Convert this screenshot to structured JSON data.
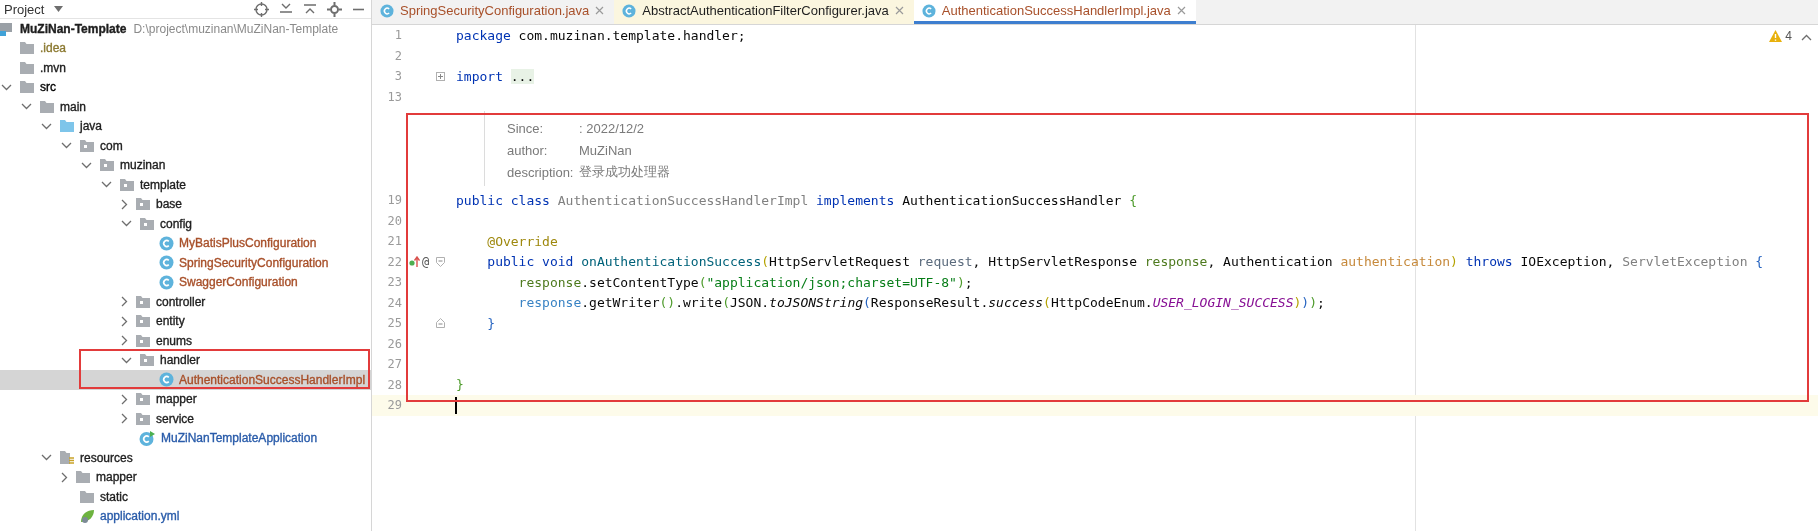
{
  "project_panel": {
    "title": "Project",
    "tree": [
      {
        "label": "MuZiNan-Template",
        "location": "D:\\project\\muzinan\\MuZiNan-Template",
        "kind": "module",
        "color": "#1e1e1e",
        "selected": false,
        "children": [
          {
            "label": ".idea",
            "kind": "folder",
            "color": "#8c7a32",
            "selected": false
          },
          {
            "label": ".mvn",
            "kind": "folder",
            "color": "#1e1e1e",
            "selected": false
          },
          {
            "label": "src",
            "kind": "folder",
            "color": "#000000",
            "expanded": true,
            "selected": false,
            "children": [
              {
                "label": "main",
                "kind": "folder",
                "color": "#1e1e1e",
                "expanded": true,
                "selected": false,
                "children": [
                  {
                    "label": "java",
                    "kind": "source-root",
                    "color": "#1e1e1e",
                    "expanded": true,
                    "selected": false,
                    "children": [
                      {
                        "label": "com",
                        "kind": "package",
                        "color": "#1e1e1e",
                        "expanded": true,
                        "selected": false,
                        "children": [
                          {
                            "label": "muzinan",
                            "kind": "package",
                            "color": "#1e1e1e",
                            "expanded": true,
                            "selected": false,
                            "children": [
                              {
                                "label": "template",
                                "kind": "package",
                                "color": "#1e1e1e",
                                "expanded": true,
                                "selected": false,
                                "children": [
                                  {
                                    "label": "base",
                                    "kind": "package",
                                    "color": "#1e1e1e",
                                    "expanded": false,
                                    "selected": false
                                  },
                                  {
                                    "label": "config",
                                    "kind": "package",
                                    "color": "#1e1e1e",
                                    "expanded": true,
                                    "selected": false,
                                    "children": [
                                      {
                                        "label": "MyBatisPlusConfiguration",
                                        "kind": "class",
                                        "color": "#a8502a",
                                        "selected": false
                                      },
                                      {
                                        "label": "SpringSecurityConfiguration",
                                        "kind": "class",
                                        "color": "#a8502a",
                                        "selected": false
                                      },
                                      {
                                        "label": "SwaggerConfiguration",
                                        "kind": "class",
                                        "color": "#a8502a",
                                        "selected": false
                                      }
                                    ]
                                  },
                                  {
                                    "label": "controller",
                                    "kind": "package",
                                    "color": "#1e1e1e",
                                    "expanded": false,
                                    "selected": false
                                  },
                                  {
                                    "label": "entity",
                                    "kind": "package",
                                    "color": "#1e1e1e",
                                    "expanded": false,
                                    "selected": false
                                  },
                                  {
                                    "label": "enums",
                                    "kind": "package",
                                    "color": "#1e1e1e",
                                    "expanded": false,
                                    "selected": false
                                  },
                                  {
                                    "label": "handler",
                                    "kind": "package",
                                    "color": "#1e1e1e",
                                    "expanded": true,
                                    "selected": false,
                                    "children": [
                                      {
                                        "label": "AuthenticationSuccessHandlerImpl",
                                        "kind": "class",
                                        "color": "#a8502a",
                                        "selected": true
                                      }
                                    ]
                                  },
                                  {
                                    "label": "mapper",
                                    "kind": "package",
                                    "color": "#1e1e1e",
                                    "expanded": false,
                                    "selected": false
                                  },
                                  {
                                    "label": "service",
                                    "kind": "package",
                                    "color": "#1e1e1e",
                                    "expanded": false,
                                    "selected": false
                                  },
                                  {
                                    "label": "MuZiNanTemplateApplication",
                                    "kind": "app-class",
                                    "color": "#2a5caa",
                                    "selected": false
                                  }
                                ]
                              }
                            ]
                          }
                        ]
                      }
                    ]
                  },
                  {
                    "label": "resources",
                    "kind": "resources",
                    "color": "#1e1e1e",
                    "expanded": true,
                    "selected": false,
                    "children": [
                      {
                        "label": "mapper",
                        "kind": "folder",
                        "color": "#1e1e1e",
                        "expanded": false,
                        "selected": false
                      },
                      {
                        "label": "static",
                        "kind": "folder",
                        "color": "#1e1e1e",
                        "selected": false
                      },
                      {
                        "label": "application.yml",
                        "kind": "yml",
                        "color": "#2a5caa",
                        "selected": false
                      }
                    ]
                  }
                ]
              }
            ]
          }
        ]
      }
    ]
  },
  "editor": {
    "tabs": [
      {
        "label": "SpringSecurityConfiguration.java",
        "kind": "class",
        "color": "#a8502a",
        "selected": false
      },
      {
        "label": "AbstractAuthenticationFilterConfigurer.java",
        "kind": "library-class",
        "color": "#1e1e1e",
        "selected": false
      },
      {
        "label": "AuthenticationSuccessHandlerImpl.java",
        "kind": "class",
        "color": "#a8502a",
        "selected": true
      }
    ],
    "warnings": "4",
    "code": [
      {
        "kind": "line",
        "number": "1",
        "current": false,
        "tokens": [
          {
            "kind": "keyword",
            "text": "package"
          },
          {
            "kind": "plain",
            "text": " com.muzinan.template.handler;"
          }
        ]
      },
      {
        "kind": "line",
        "number": "2",
        "current": false
      },
      {
        "kind": "line",
        "number": "3",
        "current": false,
        "fold": {
          "kind": "collapsed"
        },
        "tokens": [
          {
            "kind": "keyword",
            "text": "import "
          },
          {
            "kind": "folded",
            "text": "..."
          }
        ]
      },
      {
        "kind": "line",
        "number": "13",
        "current": false
      },
      {
        "kind": "doc",
        "rows": [
          {
            "label": "Since:",
            "value": ": 2022/12/2"
          },
          {
            "label": "author:",
            "value": "MuZiNan"
          },
          {
            "label": "description:",
            "value": "登录成功处理器"
          }
        ]
      },
      {
        "kind": "line",
        "number": "19",
        "current": false,
        "tokens": [
          {
            "kind": "keyword",
            "text": "public class "
          },
          {
            "kind": "muted",
            "text": "AuthenticationSuccessHandlerImpl "
          },
          {
            "kind": "keyword",
            "text": "implements"
          },
          {
            "kind": "plain",
            "text": " AuthenticationSuccessHandler "
          },
          {
            "kind": "bracket-green",
            "text": "{"
          }
        ]
      },
      {
        "kind": "line",
        "number": "20",
        "current": false
      },
      {
        "kind": "line",
        "number": "21",
        "current": false,
        "tokens": [
          {
            "kind": "annotation",
            "text": "    @Override"
          }
        ]
      },
      {
        "kind": "line",
        "number": "22",
        "current": false,
        "fold": {
          "kind": "start"
        },
        "gutter": {
          "kind": "implements",
          "text": "@"
        },
        "tokens": [
          {
            "kind": "keyword",
            "text": "    public void "
          },
          {
            "kind": "method",
            "text": "onAuthenticationSuccess"
          },
          {
            "kind": "bracket-yellow",
            "text": "("
          },
          {
            "kind": "plain",
            "text": "HttpServletRequest "
          },
          {
            "kind": "param-a",
            "text": "request"
          },
          {
            "kind": "plain",
            "text": ", HttpServletResponse "
          },
          {
            "kind": "param-b",
            "text": "response"
          },
          {
            "kind": "plain",
            "text": ", Authentication "
          },
          {
            "kind": "param-c",
            "text": "authentication"
          },
          {
            "kind": "bracket-yellow",
            "text": ")"
          },
          {
            "kind": "keyword",
            "text": " throws"
          },
          {
            "kind": "plain",
            "text": " IOException, "
          },
          {
            "kind": "muted",
            "text": "ServletException "
          },
          {
            "kind": "bracket-blue",
            "text": "{"
          }
        ]
      },
      {
        "kind": "line",
        "number": "23",
        "current": false,
        "tokens": [
          {
            "kind": "param-b",
            "text": "        response"
          },
          {
            "kind": "plain",
            "text": ".setContentType"
          },
          {
            "kind": "bracket-green",
            "text": "("
          },
          {
            "kind": "string",
            "text": "\"application/json;charset=UTF-8\""
          },
          {
            "kind": "bracket-green",
            "text": ")"
          },
          {
            "kind": "plain",
            "text": ";"
          }
        ]
      },
      {
        "kind": "line",
        "number": "24",
        "current": false,
        "tokens": [
          {
            "kind": "local",
            "text": "        response"
          },
          {
            "kind": "plain",
            "text": ".getWriter"
          },
          {
            "kind": "bracket-green",
            "text": "()"
          },
          {
            "kind": "plain",
            "text": ".write"
          },
          {
            "kind": "bracket-green",
            "text": "("
          },
          {
            "kind": "plain",
            "text": "JSON."
          },
          {
            "kind": "static",
            "text": "toJSONString"
          },
          {
            "kind": "bracket-blue",
            "text": "("
          },
          {
            "kind": "plain",
            "text": "ResponseResult."
          },
          {
            "kind": "static",
            "text": "success"
          },
          {
            "kind": "bracket-yellow",
            "text": "("
          },
          {
            "kind": "plain",
            "text": "HttpCodeEnum."
          },
          {
            "kind": "constant",
            "text": "USER_LOGIN_SUCCESS"
          },
          {
            "kind": "bracket-yellow",
            "text": ")"
          },
          {
            "kind": "bracket-blue",
            "text": ")"
          },
          {
            "kind": "bracket-green",
            "text": ")"
          },
          {
            "kind": "plain",
            "text": ";"
          }
        ]
      },
      {
        "kind": "line",
        "number": "25",
        "current": false,
        "fold": {
          "kind": "end"
        },
        "tokens": [
          {
            "kind": "bracket-blue",
            "text": "    }"
          }
        ]
      },
      {
        "kind": "line",
        "number": "26",
        "current": false
      },
      {
        "kind": "line",
        "number": "27",
        "current": false
      },
      {
        "kind": "line",
        "number": "28",
        "current": false,
        "tokens": [
          {
            "kind": "bracket-green",
            "text": "}"
          }
        ]
      },
      {
        "kind": "line",
        "number": "29",
        "current": true
      }
    ]
  }
}
